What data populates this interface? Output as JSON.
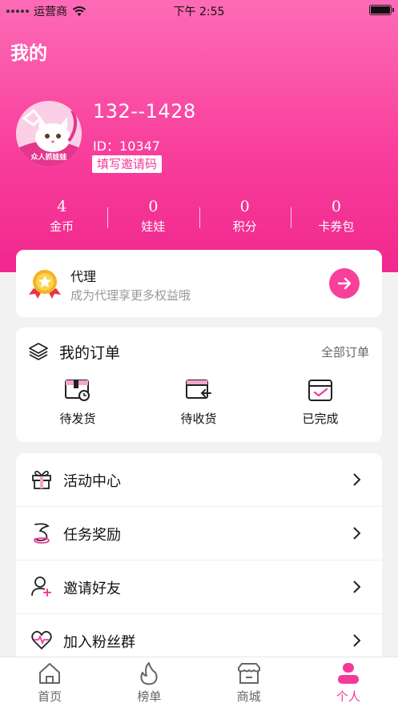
{
  "status_bar": {
    "carrier": "运营商",
    "time": "下午 2:55"
  },
  "page": {
    "title": "我的"
  },
  "profile": {
    "phone": "132--1428",
    "user_id": "ID：10347",
    "invite_label": "填写邀请码",
    "avatar_badge": "众人抓娃娃"
  },
  "stats": [
    {
      "value": "4",
      "label": "金币"
    },
    {
      "value": "0",
      "label": "娃娃"
    },
    {
      "value": "0",
      "label": "积分"
    },
    {
      "value": "0",
      "label": "卡券包"
    }
  ],
  "agent": {
    "title": "代理",
    "subtitle": "成为代理享更多权益哦"
  },
  "orders": {
    "title": "我的订单",
    "all_label": "全部订单",
    "items": [
      {
        "label": "待发货",
        "icon": "box-clock-icon"
      },
      {
        "label": "待收货",
        "icon": "box-return-icon"
      },
      {
        "label": "已完成",
        "icon": "calendar-check-icon"
      }
    ]
  },
  "menu": [
    {
      "label": "活动中心",
      "icon": "gift-icon"
    },
    {
      "label": "任务奖励",
      "icon": "task-icon"
    },
    {
      "label": "邀请好友",
      "icon": "add-user-icon"
    },
    {
      "label": "加入粉丝群",
      "icon": "heart-pulse-icon"
    }
  ],
  "tabs": [
    {
      "label": "首页",
      "icon": "home-icon",
      "active": false
    },
    {
      "label": "榜单",
      "icon": "flame-icon",
      "active": false
    },
    {
      "label": "商城",
      "icon": "shop-icon",
      "active": false
    },
    {
      "label": "个人",
      "icon": "person-icon",
      "active": true
    }
  ],
  "colors": {
    "accent": "#f83f9c",
    "header_top": "#fd6bb6",
    "header_bottom": "#f1278d"
  }
}
